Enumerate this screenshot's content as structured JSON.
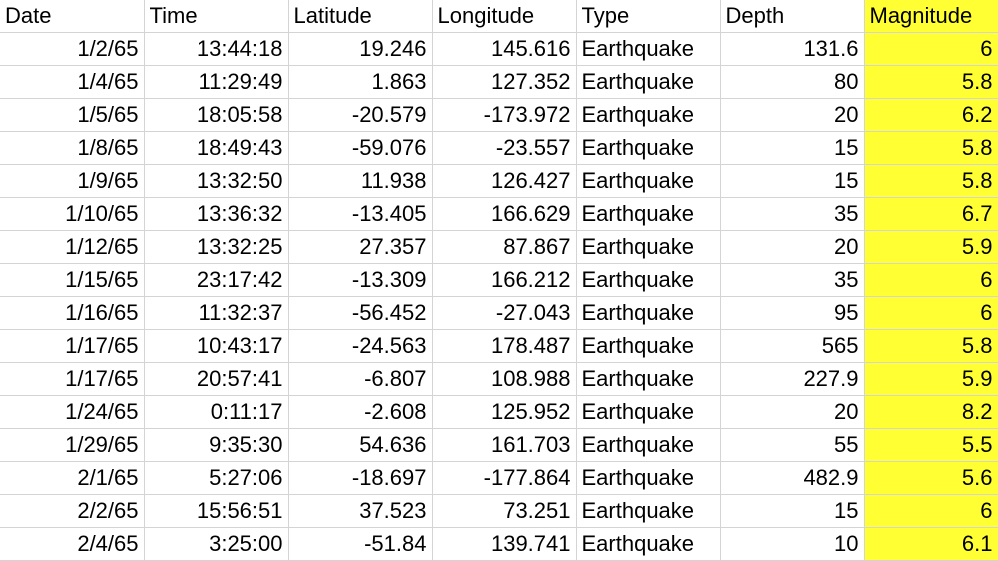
{
  "headers": [
    "Date",
    "Time",
    "Latitude",
    "Longitude",
    "Type",
    "Depth",
    "Magnitude"
  ],
  "rows": [
    [
      "1/2/65",
      "13:44:18",
      "19.246",
      "145.616",
      "Earthquake",
      "131.6",
      "6"
    ],
    [
      "1/4/65",
      "11:29:49",
      "1.863",
      "127.352",
      "Earthquake",
      "80",
      "5.8"
    ],
    [
      "1/5/65",
      "18:05:58",
      "-20.579",
      "-173.972",
      "Earthquake",
      "20",
      "6.2"
    ],
    [
      "1/8/65",
      "18:49:43",
      "-59.076",
      "-23.557",
      "Earthquake",
      "15",
      "5.8"
    ],
    [
      "1/9/65",
      "13:32:50",
      "11.938",
      "126.427",
      "Earthquake",
      "15",
      "5.8"
    ],
    [
      "1/10/65",
      "13:36:32",
      "-13.405",
      "166.629",
      "Earthquake",
      "35",
      "6.7"
    ],
    [
      "1/12/65",
      "13:32:25",
      "27.357",
      "87.867",
      "Earthquake",
      "20",
      "5.9"
    ],
    [
      "1/15/65",
      "23:17:42",
      "-13.309",
      "166.212",
      "Earthquake",
      "35",
      "6"
    ],
    [
      "1/16/65",
      "11:32:37",
      "-56.452",
      "-27.043",
      "Earthquake",
      "95",
      "6"
    ],
    [
      "1/17/65",
      "10:43:17",
      "-24.563",
      "178.487",
      "Earthquake",
      "565",
      "5.8"
    ],
    [
      "1/17/65",
      "20:57:41",
      "-6.807",
      "108.988",
      "Earthquake",
      "227.9",
      "5.9"
    ],
    [
      "1/24/65",
      "0:11:17",
      "-2.608",
      "125.952",
      "Earthquake",
      "20",
      "8.2"
    ],
    [
      "1/29/65",
      "9:35:30",
      "54.636",
      "161.703",
      "Earthquake",
      "55",
      "5.5"
    ],
    [
      "2/1/65",
      "5:27:06",
      "-18.697",
      "-177.864",
      "Earthquake",
      "482.9",
      "5.6"
    ],
    [
      "2/2/65",
      "15:56:51",
      "37.523",
      "73.251",
      "Earthquake",
      "15",
      "6"
    ],
    [
      "2/4/65",
      "3:25:00",
      "-51.84",
      "139.741",
      "Earthquake",
      "10",
      "6.1"
    ]
  ],
  "colors": {
    "highlight": "#ffff33",
    "gridline": "#d4d4d4"
  }
}
